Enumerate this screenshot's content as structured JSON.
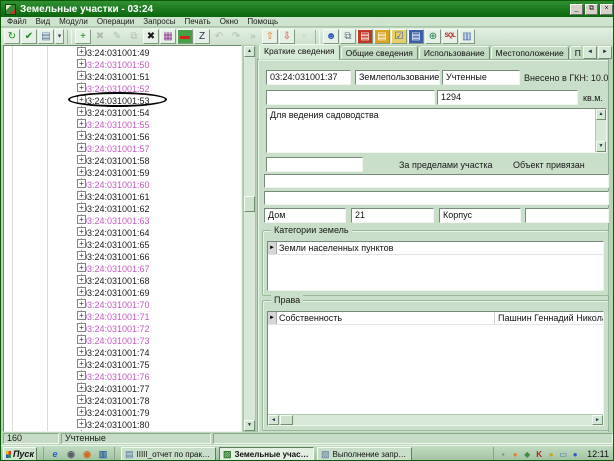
{
  "colors": {
    "titlebar": "#0d6e0d",
    "panel": "#c9dfc9",
    "tree_pink": "#c45ac4",
    "white": "#ffffff"
  },
  "window": {
    "title": "Земельные участки - 03:24",
    "controls": {
      "minimize": "_",
      "restore": "⧉",
      "close": "×"
    }
  },
  "menu": [
    "Файл",
    "Вид",
    "Модули",
    "Операции",
    "Запросы",
    "Печать",
    "Окно",
    "Помощь"
  ],
  "toolbar": {
    "buttons": [
      {
        "name": "refresh-button",
        "glyph": "↻",
        "fg": "#1d8a1d"
      },
      {
        "name": "confirm-button",
        "glyph": "✔",
        "fg": "#1d8a1d"
      },
      {
        "name": "print-button",
        "glyph": "▤",
        "fg": "#51719a"
      },
      {
        "name": "print-dropdown",
        "glyph": "▾",
        "fg": "#444",
        "narrow": true
      },
      {
        "sep": true
      },
      {
        "name": "add-record-button",
        "glyph": "+",
        "fg": "#0b8a0b"
      },
      {
        "name": "delete-record-button",
        "glyph": "✖",
        "fg": "#b0bcb0",
        "disabled": true
      },
      {
        "name": "edit-record-button",
        "glyph": "✎",
        "fg": "#b0bcb0",
        "disabled": true
      },
      {
        "name": "duplicate-record-button",
        "glyph": "⧉",
        "fg": "#b0bcb0",
        "disabled": true
      },
      {
        "name": "close-table-button",
        "glyph": "✖",
        "fg": "#1a1a1a"
      },
      {
        "name": "grid-view-button",
        "glyph": "▦",
        "fg": "#8d3a8d"
      },
      {
        "name": "import-table-button",
        "glyph": "▬",
        "fg": "#d02818",
        "bg": "#46a046"
      },
      {
        "name": "edit-field-button",
        "glyph": "Z",
        "fg": "#26324e"
      },
      {
        "name": "undo-button",
        "glyph": "↶",
        "fg": "#b0bcb0",
        "disabled": true
      },
      {
        "name": "redo-button",
        "glyph": "↷",
        "fg": "#b0bcb0",
        "disabled": true
      },
      {
        "name": "forward-button",
        "glyph": "»",
        "fg": "#a8b4a8",
        "disabled": true
      },
      {
        "name": "export-button",
        "glyph": "⇧",
        "fg": "#e07a1e"
      },
      {
        "name": "load-button",
        "glyph": "⇩",
        "fg": "#d1472b"
      },
      {
        "name": "detach-button",
        "glyph": "▫",
        "fg": "#b0bcb0",
        "disabled": true
      },
      {
        "sep": true
      },
      {
        "name": "users-button",
        "glyph": "☻",
        "fg": "#2d5bb8"
      },
      {
        "name": "copy-docs-button",
        "glyph": "⧉",
        "fg": "#5a6f84"
      },
      {
        "name": "red-book-button",
        "glyph": "▤",
        "fg": "#ffffff",
        "bg": "#c03724"
      },
      {
        "name": "yellow-book-button",
        "glyph": "▤",
        "fg": "#ffffff",
        "bg": "#d9a41e"
      },
      {
        "name": "register-check-button",
        "glyph": "☑",
        "fg": "#2d5bb8",
        "bg": "#e9cf6a"
      },
      {
        "name": "books-stack-button",
        "glyph": "▤",
        "fg": "#ffffff",
        "bg": "#3c5fa8"
      },
      {
        "name": "globe-button",
        "glyph": "⊕",
        "fg": "#1f7a46"
      },
      {
        "name": "sql-query-button",
        "text": "SQL",
        "fg": "#b02222"
      },
      {
        "name": "database-button",
        "glyph": "▥",
        "fg": "#3b5fb0"
      }
    ]
  },
  "tree": {
    "circled_label": "03:24:031001:53",
    "items": [
      {
        "label": "03:24:031001:49",
        "pink": false
      },
      {
        "label": "03:24:031001:50",
        "pink": true
      },
      {
        "label": "03:24:031001:51",
        "pink": false
      },
      {
        "label": "03:24:031001:52",
        "pink": true
      },
      {
        "label": "03:24:031001:53",
        "pink": false
      },
      {
        "label": "03:24:031001:54",
        "pink": false
      },
      {
        "label": "03:24:031001:55",
        "pink": true
      },
      {
        "label": "03:24:031001:56",
        "pink": false
      },
      {
        "label": "03:24:031001:57",
        "pink": true
      },
      {
        "label": "03:24:031001:58",
        "pink": false
      },
      {
        "label": "03:24:031001:59",
        "pink": false
      },
      {
        "label": "03:24:031001:60",
        "pink": true
      },
      {
        "label": "03:24:031001:61",
        "pink": false
      },
      {
        "label": "03:24:031001:62",
        "pink": false
      },
      {
        "label": "03:24:031001:63",
        "pink": true
      },
      {
        "label": "03:24:031001:64",
        "pink": false
      },
      {
        "label": "03:24:031001:65",
        "pink": false
      },
      {
        "label": "03:24:031001:66",
        "pink": false
      },
      {
        "label": "03:24:031001:67",
        "pink": true
      },
      {
        "label": "03:24:031001:68",
        "pink": false
      },
      {
        "label": "03:24:031001:69",
        "pink": false
      },
      {
        "label": "03:24:031001:70",
        "pink": true
      },
      {
        "label": "03:24:031001:71",
        "pink": true
      },
      {
        "label": "03:24:031001:72",
        "pink": true
      },
      {
        "label": "03:24:031001:73",
        "pink": true
      },
      {
        "label": "03:24:031001:74",
        "pink": false
      },
      {
        "label": "03:24:031001:75",
        "pink": false
      },
      {
        "label": "03:24:031001:76",
        "pink": true
      },
      {
        "label": "03:24:031001:77",
        "pink": false
      },
      {
        "label": "03:24:031001:78",
        "pink": false
      },
      {
        "label": "03:24:031001:79",
        "pink": false
      },
      {
        "label": "03:24:031001:80",
        "pink": false
      }
    ]
  },
  "tabs": {
    "active_index": 0,
    "items": [
      "Краткие сведения",
      "Общие сведения",
      "Использование",
      "Местоположение",
      "Площ"
    ],
    "scroll_left": "◄",
    "scroll_right": "►"
  },
  "form": {
    "cadastral_number": "03:24:031001:37",
    "land_use": "Землепользование",
    "record_status": "Учтенные",
    "gkn_label": "Внесено в ГКН: 10.0",
    "area_value": "1294",
    "area_unit": "кв.м.",
    "purpose_text": "Для ведения садоводства",
    "outside_label": "За пределами участка",
    "attached_label": "Объект привязан",
    "house_label": "Дом",
    "house_value": "21",
    "building_label": "Корпус",
    "building_value": "",
    "categories": {
      "title": "Категории земель",
      "rows": [
        "Земли населенных пунктов"
      ]
    },
    "rights": {
      "title": "Права",
      "rows": [
        {
          "type": "Собственность",
          "holder": "Пашнин Геннадий Николае"
        }
      ]
    }
  },
  "status_bar": {
    "count": "160",
    "status": "Учтенные"
  },
  "taskbar": {
    "start_label": "Пуск",
    "quicklaunch": [
      {
        "name": "quicklaunch-ie-icon",
        "glyph": "e",
        "fg": "#2a63c8",
        "italic": true
      },
      {
        "name": "quicklaunch-mail-icon",
        "glyph": "◉",
        "fg": "#5a5a66"
      },
      {
        "name": "quicklaunch-media-icon",
        "glyph": "◉",
        "fg": "#cf6a1e"
      },
      {
        "name": "quicklaunch-desktop-icon",
        "glyph": "▥",
        "fg": "#33689a"
      }
    ],
    "tasks": [
      {
        "label": "IIIII_отчет по практи...",
        "icon_glyph": "▤",
        "icon_fg": "#4a6fa5",
        "active": false
      },
      {
        "label": "Земельные участ...",
        "icon_glyph": "▨",
        "icon_fg": "#2a7a2a",
        "active": true
      },
      {
        "label": "Выполнение запроса",
        "icon_glyph": "▧",
        "icon_fg": "#50719a",
        "active": false
      }
    ],
    "tray": [
      {
        "name": "tray-icon-1",
        "glyph": "▪",
        "fg": "#7a8a7a"
      },
      {
        "name": "tray-icon-2",
        "glyph": "●",
        "fg": "#e08428"
      },
      {
        "name": "tray-icon-3",
        "glyph": "◆",
        "fg": "#3e8e3e"
      },
      {
        "name": "tray-icon-4",
        "glyph": "K",
        "fg": "#c31c1c"
      },
      {
        "name": "tray-icon-5",
        "glyph": "●",
        "fg": "#caa31f"
      },
      {
        "name": "tray-icon-6",
        "glyph": "▭",
        "fg": "#3566b5"
      },
      {
        "name": "tray-icon-7",
        "glyph": "●",
        "fg": "#2f5bc9"
      }
    ],
    "clock": "12:11"
  }
}
